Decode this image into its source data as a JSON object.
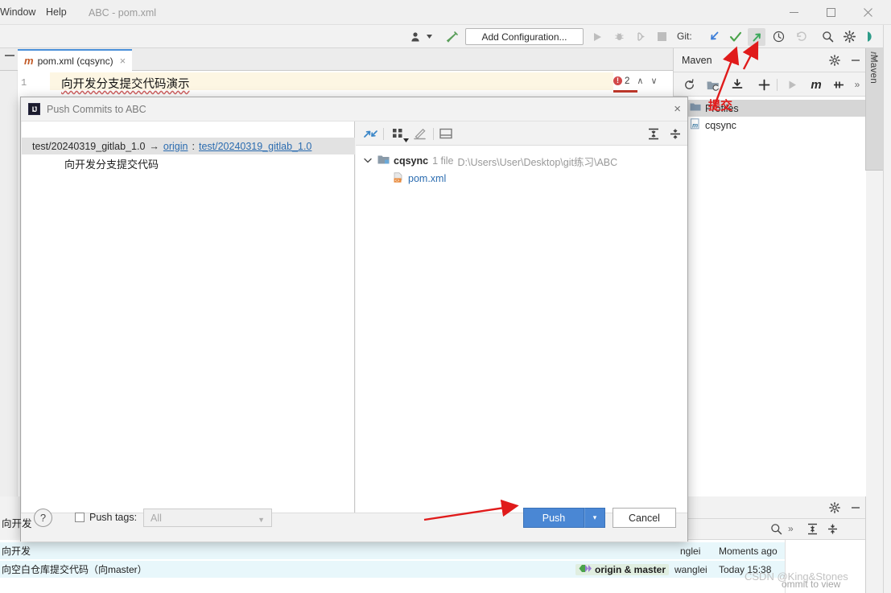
{
  "window": {
    "title": "ABC - pom.xml",
    "menus": [
      {
        "label": "Window",
        "accel": "W"
      },
      {
        "label": "Help",
        "accel": "H"
      }
    ],
    "controls": {
      "minimize": "minimize-icon",
      "maximize": "maximize-icon",
      "close": "close-icon"
    }
  },
  "toolbar": {
    "add_configuration": "Add Configuration...",
    "git_label": "Git:",
    "icons": [
      "user-avatar-icon",
      "dropdown-arrow-icon",
      "build-hammer-icon",
      "run-icon",
      "debug-icon",
      "run-coverage-icon",
      "stop-icon",
      "git-update-icon",
      "git-commit-icon",
      "git-push-icon",
      "git-history-icon",
      "git-rollback-icon",
      "search-everywhere-icon",
      "settings-gear-icon",
      "ide-help-icon"
    ]
  },
  "editor": {
    "tab": {
      "icon": "maven-m-icon",
      "label": "pom.xml (cqsync)",
      "close": "×"
    },
    "line_number": "1",
    "code_text": "向开发分支提交代码演示",
    "error_count": "2",
    "error_icon": "!",
    "nav_up": "∧",
    "nav_down": "∨"
  },
  "maven": {
    "title": "Maven",
    "side_tab_label": "Maven",
    "side_tab_icon": "maven-m-icon",
    "header_icons": [
      "settings-gear-icon",
      "hide-minimize-icon"
    ],
    "toolbar_icons": [
      "reimport-refresh-icon",
      "generate-sources-icon",
      "download-sources-icon",
      "add-maven-project-icon",
      "run-maven-goal-icon",
      "execute-maven-goal-m-icon",
      "toggle-skip-tests-icon",
      "more-chevrons-icon"
    ],
    "tree": [
      {
        "label": "Profiles",
        "icon": "folder-icon",
        "selected": true
      },
      {
        "label": "cqsync",
        "icon": "maven-project-icon",
        "selected": false
      }
    ]
  },
  "dialog": {
    "title": "Push Commits to ABC",
    "title_icon": "intellij-logo-icon",
    "close_icon": "×",
    "branch": {
      "local": "test/20240319_gitlab_1.0",
      "arrow": "→",
      "remote_name": "origin",
      "colon": ":",
      "remote_branch": "test/20240319_gitlab_1.0"
    },
    "commit_message": "向开发分支提交代码",
    "right_toolbar_icons": [
      "expand-diff-icon",
      "group-by-icon",
      "group-by-dropdown-icon",
      "show-diff-edit-icon",
      "preview-pane-icon",
      "expand-all-icon",
      "collapse-all-icon"
    ],
    "file_tree": {
      "expand_chevron": "⌄",
      "root_icon": "module-folder-icon",
      "root_label": "cqsync",
      "file_count": "1 file",
      "path": "D:\\Users\\User\\Desktop\\git练习\\ABC",
      "children": [
        {
          "icon": "xml-file-icon",
          "label": "pom.xml"
        }
      ]
    },
    "footer": {
      "help": "?",
      "push_tags_label": "Push tags:",
      "push_tags_value": "All",
      "push_tags_checked": false,
      "push_button": "Push",
      "push_dropdown": "▾",
      "cancel_button": "Cancel"
    }
  },
  "git_log": {
    "header_icons": [
      "settings-gear-icon",
      "hide-minimize-icon"
    ],
    "search_icon": "search-icon",
    "toolbar_icons": [
      "more-chevrons-icon",
      "expand-all-icon",
      "collapse-all-icon"
    ],
    "rows": [
      {
        "message": "向开发",
        "author": "nglei",
        "date": "Moments ago",
        "tag": ""
      },
      {
        "message": "向空白仓库提交代码（向master）",
        "author": "wanglei",
        "date": "Today 15:38",
        "tag": "origin & master",
        "tag_icon": "branch-tag-icon"
      }
    ],
    "detail_hint": "ommit to view"
  },
  "annotations": {
    "handwritten_red_text": "提交",
    "arrows": [
      "arrow-to-git-push-toolbar",
      "arrow-to-maven-download",
      "arrow-to-push-button"
    ],
    "accent_color": "#e01b1b"
  },
  "watermark": "CSDN @King&Stones",
  "colors": {
    "accent_blue": "#4a87d4",
    "link_blue": "#2b6cb0",
    "error_red": "#d2494a",
    "annotation_red": "#e01b1b",
    "selection_cyan": "#e8f7fb"
  }
}
